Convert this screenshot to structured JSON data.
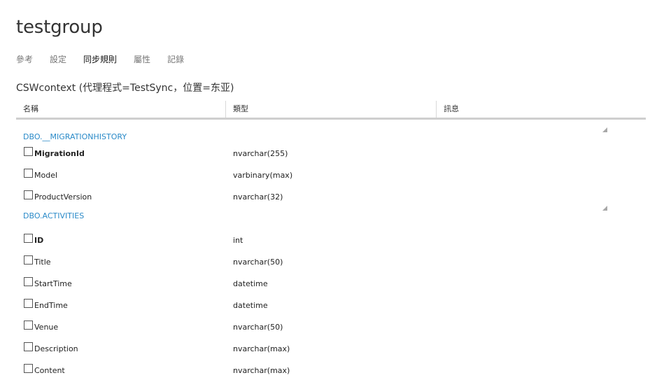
{
  "title": "testgroup",
  "tabs": [
    {
      "label": "參考",
      "active": false
    },
    {
      "label": "設定",
      "active": false
    },
    {
      "label": "同步規則",
      "active": true
    },
    {
      "label": "屬性",
      "active": false
    },
    {
      "label": "記錄",
      "active": false
    }
  ],
  "context_line": "CSWcontext (代理程式=TestSync，位置=东亚)",
  "columns": {
    "name": "名稱",
    "type": "類型",
    "message": "訊息"
  },
  "groups": [
    {
      "label": "DBO.__MIGRATIONHISTORY",
      "icon": "collapse-triangle-icon",
      "rows": [
        {
          "name": "MigrationId",
          "type": "nvarchar(255)",
          "message": "",
          "bold": true,
          "checked": false
        },
        {
          "name": "Model",
          "type": "varbinary(max)",
          "message": "",
          "bold": false,
          "checked": false
        },
        {
          "name": "ProductVersion",
          "type": "nvarchar(32)",
          "message": "",
          "bold": false,
          "checked": false
        }
      ]
    },
    {
      "label": "DBO.ACTIVITIES",
      "icon": "collapse-triangle-icon",
      "rows": [
        {
          "name": "ID",
          "type": "int",
          "message": "",
          "bold": true,
          "checked": false
        },
        {
          "name": "Title",
          "type": "nvarchar(50)",
          "message": "",
          "bold": false,
          "checked": false
        },
        {
          "name": "StartTime",
          "type": "datetime",
          "message": "",
          "bold": false,
          "checked": false
        },
        {
          "name": "EndTime",
          "type": "datetime",
          "message": "",
          "bold": false,
          "checked": false
        },
        {
          "name": "Venue",
          "type": "nvarchar(50)",
          "message": "",
          "bold": false,
          "checked": false
        },
        {
          "name": "Description",
          "type": "nvarchar(max)",
          "message": "",
          "bold": false,
          "checked": false
        },
        {
          "name": "Content",
          "type": "nvarchar(max)",
          "message": "",
          "bold": false,
          "checked": false
        }
      ]
    }
  ],
  "colors": {
    "group_link": "#2a8ac8",
    "header_rule": "#cfcfcf",
    "tab_inactive": "#777777",
    "tab_active": "#111111"
  }
}
